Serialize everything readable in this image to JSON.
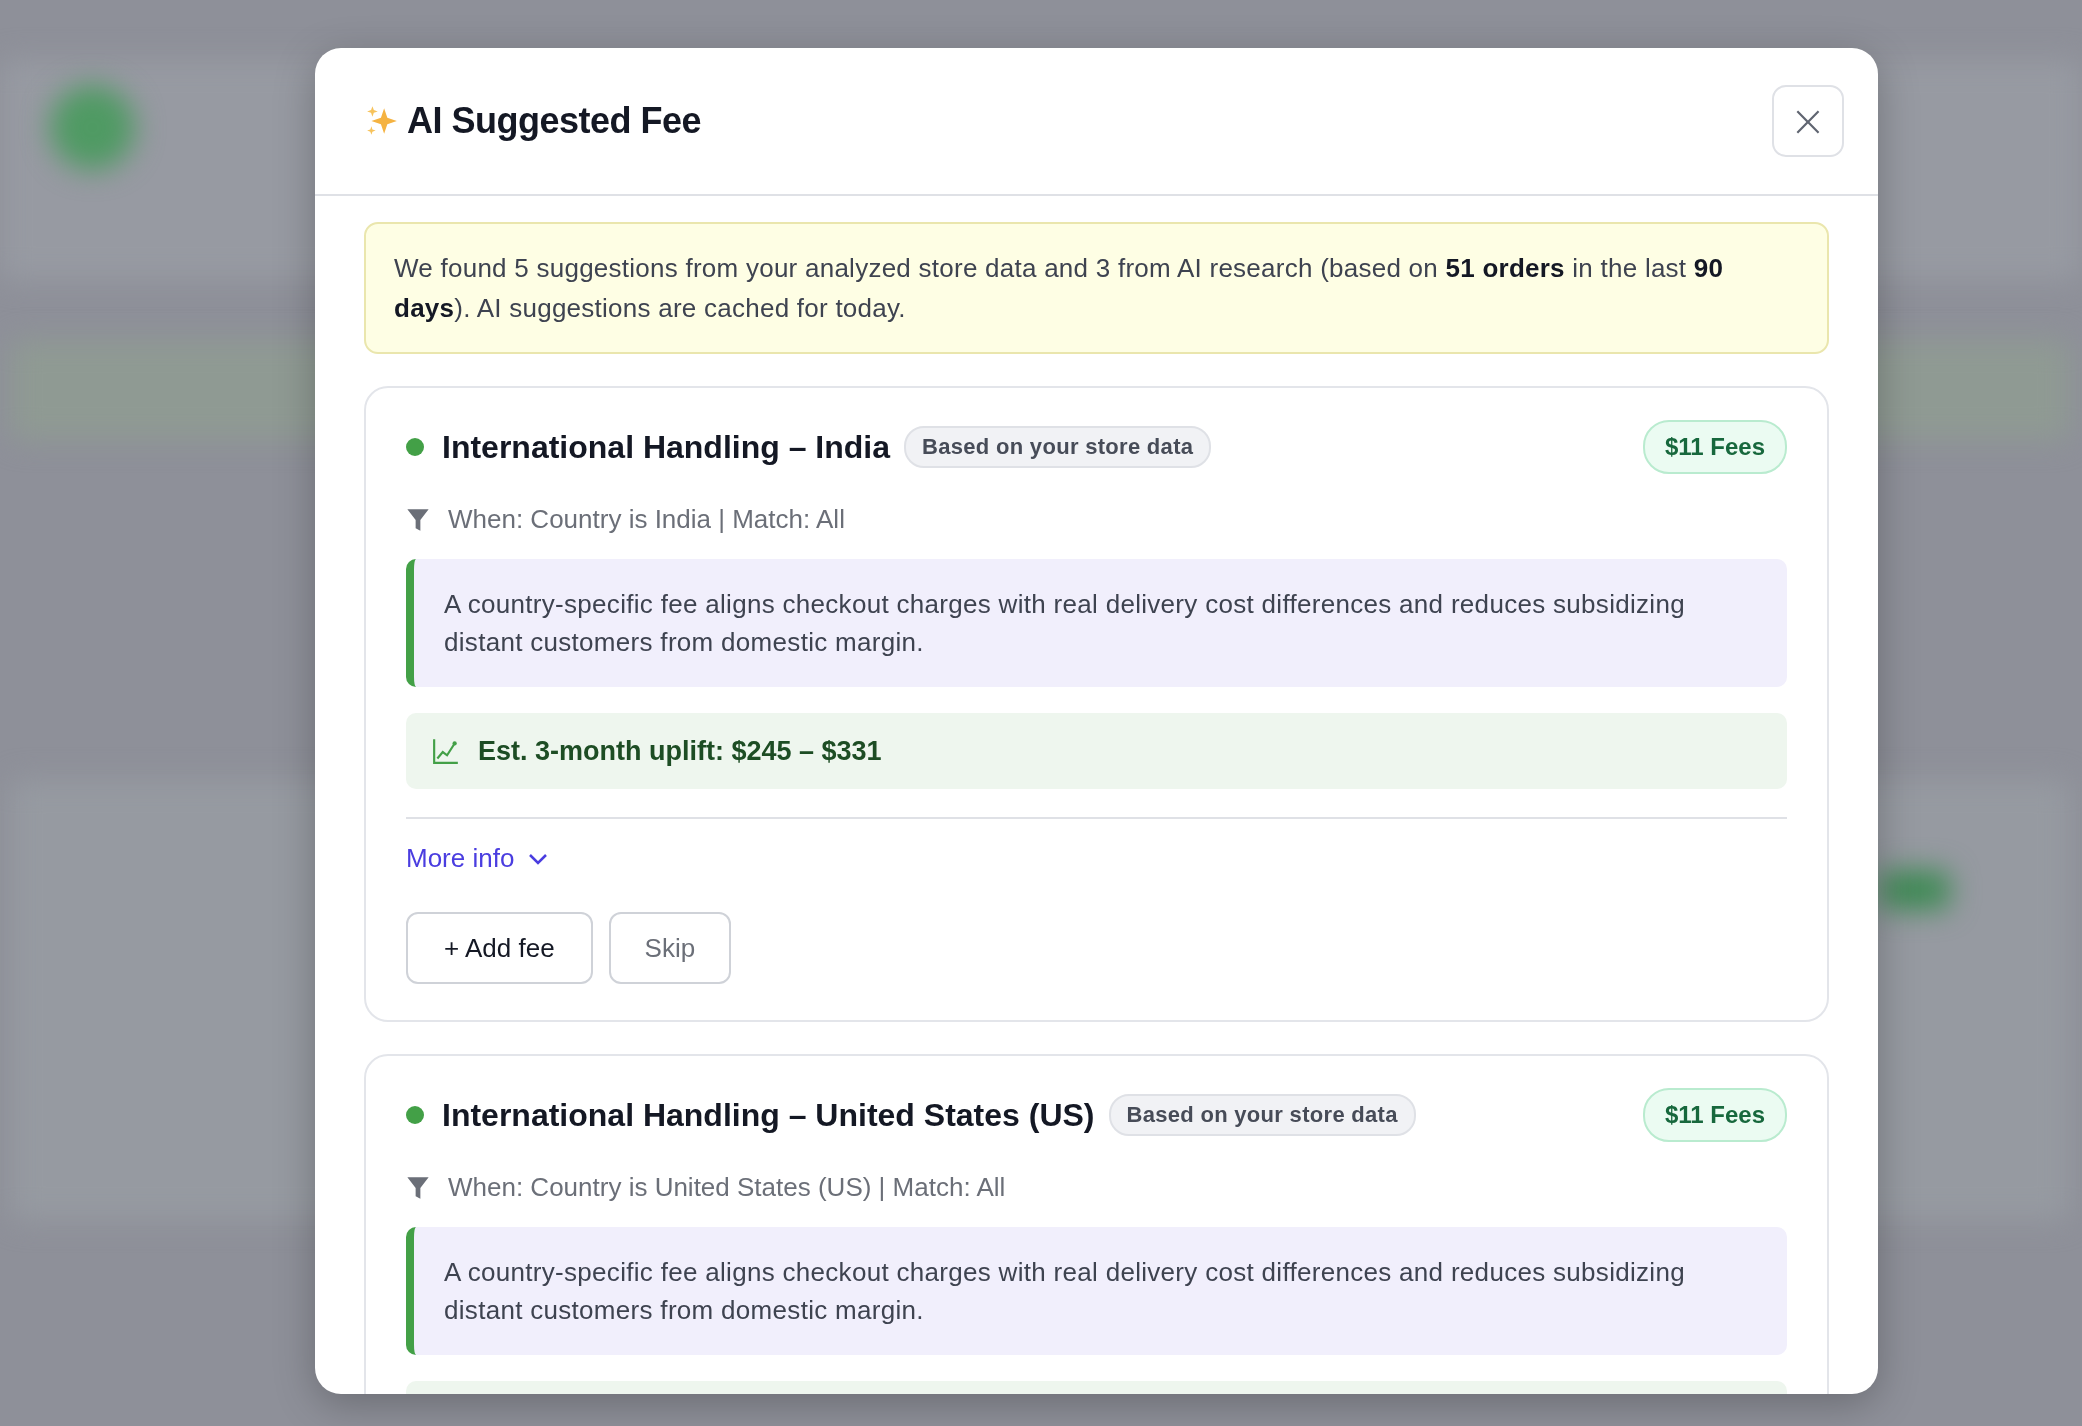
{
  "dialog": {
    "title": "AI Suggested Fee",
    "close_label": "×"
  },
  "notice": "We found 5 suggestions from your analyzed store data and 3 from AI research (based on **51 orders** in the last **90 days**). AI suggestions are cached for today.",
  "suggestions": [
    {
      "title": "International Handling – India",
      "source": "Based on your store data",
      "color": "#43a047",
      "amount": "$11 Fees",
      "condition": "When: Country is India | Match: All",
      "reason": "A country-specific fee aligns checkout charges with real delivery cost differences and reduces subsidizing distant customers from domestic margin.",
      "uplift": "Est. 3-month uplift: $245 – $331",
      "more_info": "More info",
      "expanded": false,
      "actions": [
        "+ Add fee",
        "Skip"
      ]
    },
    {
      "title": "International Handling – United States (US)",
      "source": "Based on your store data",
      "color": "#43a047",
      "amount": "$11 Fees",
      "condition": "When: Country is United States (US) | Match: All",
      "reason": "A country-specific fee aligns checkout charges with real delivery cost differences and reduces subsidizing distant customers from domestic margin.",
      "uplift_cut_off": true
    }
  ]
}
